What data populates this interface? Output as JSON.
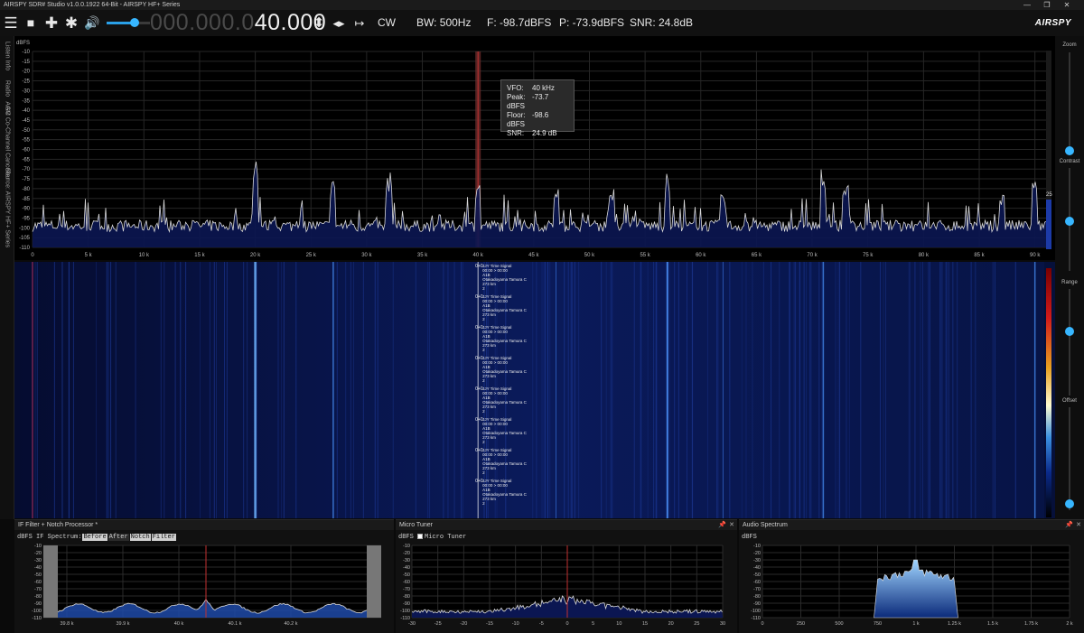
{
  "window": {
    "title": "AIRSPY SDR# Studio v1.0.0.1922 64-Bit - AIRSPY HF+ Series",
    "minimize": "—",
    "restore": "❐",
    "close": "✕"
  },
  "toolbar": {
    "menu_icon": "☰",
    "stop_icon": "■",
    "add_icon": "✚",
    "settings_icon": "✱",
    "speaker_icon": "🔊",
    "volume_level": 0.6,
    "frequency_dim": "000.000.0",
    "frequency_lit": "40.000",
    "step_updown_icon": "⬍",
    "tune_leftright_icon": "◂▸",
    "span_icon": "↦",
    "mode": "CW",
    "bandwidth": "BW: 500Hz",
    "floor": "F: -98.7dBFS",
    "peak": "P: -73.9dBFS",
    "snr": "SNR: 24.8dB",
    "brand": "AIRSPY"
  },
  "left_tabs": [
    "Listen Info",
    "Radio",
    "AGC",
    "AM Co-Channel Canceller",
    "Source: AIRSPY HF+ Series"
  ],
  "spectrum": {
    "unit": "dBFS",
    "y_ticks": [
      "-10",
      "-15",
      "-20",
      "-25",
      "-30",
      "-35",
      "-40",
      "-45",
      "-50",
      "-55",
      "-60",
      "-65",
      "-70",
      "-75",
      "-80",
      "-85",
      "-90",
      "-95",
      "-100",
      "-105",
      "-110"
    ],
    "x_ticks": [
      "0",
      "5 k",
      "10 k",
      "15 k",
      "20 k",
      "25 k",
      "30 k",
      "35 k",
      "40 k",
      "45 k",
      "50 k",
      "55 k",
      "60 k",
      "65 k",
      "70 k",
      "75 k",
      "80 k",
      "85 k",
      "90 k"
    ],
    "vfo_khz": 40,
    "tooltip": {
      "vfo_label": "VFO:",
      "vfo_value": "40 kHz",
      "peak_label": "Peak:",
      "peak_value": "-73.7 dBFS",
      "floor_label": "Floor:",
      "floor_value": "-98.6 dBFS",
      "snr_label": "SNR:",
      "snr_value": "24.9 dB"
    }
  },
  "waterfall": {
    "annotation_lines": [
      "JJY Time Signal",
      "00:00 > 00:00",
      "A1B",
      "Otakadoyama Tamura C",
      "273 km",
      "2"
    ],
    "annotation_prefix": "0+0",
    "annotation_count": 8
  },
  "right_panel": {
    "zoom_label": "Zoom",
    "contrast_label": "Contrast",
    "range_label": "Range",
    "offset_label": "Offset",
    "level_value": "25",
    "level_fraction": 0.25
  },
  "if_panel": {
    "title": "IF Filter + Notch Processor *",
    "unit": "dBFS",
    "spectrum_label": "IF Spectrum:",
    "chips": [
      "Before",
      "After",
      "Notch",
      "Filter"
    ],
    "y_ticks": [
      "-10",
      "-20",
      "-30",
      "-40",
      "-50",
      "-60",
      "-70",
      "-80",
      "-90",
      "-100",
      "-110"
    ],
    "x_ticks": [
      "39.8 k",
      "39.9 k",
      "40 k",
      "40.1 k",
      "40.2 k"
    ]
  },
  "micro_tuner": {
    "title": "Micro Tuner",
    "unit": "dBFS",
    "checkbox_label": "Micro Tuner",
    "pin_icon": "📌",
    "close_icon": "✕",
    "y_ticks": [
      "-10",
      "-20",
      "-30",
      "-40",
      "-50",
      "-60",
      "-70",
      "-80",
      "-90",
      "-100",
      "-110"
    ],
    "x_ticks": [
      "-30",
      "-25",
      "-20",
      "-15",
      "-10",
      "-5",
      "0",
      "5",
      "10",
      "15",
      "20",
      "25",
      "30"
    ]
  },
  "audio_spectrum": {
    "title": "Audio Spectrum",
    "unit": "dBFS",
    "pin_icon": "📌",
    "close_icon": "✕",
    "y_ticks": [
      "-10",
      "-20",
      "-30",
      "-40",
      "-50",
      "-60",
      "-70",
      "-80",
      "-90",
      "-100",
      "-110"
    ],
    "x_ticks": [
      "0",
      "250",
      "500",
      "750",
      "1 k",
      "1.25 k",
      "1.5 k",
      "1.75 k",
      "2 k"
    ]
  },
  "colors": {
    "accent": "#37b6ff",
    "trace": "#d9d9d9",
    "fill": "#0b1652",
    "vfo_marker": "#c03030"
  }
}
